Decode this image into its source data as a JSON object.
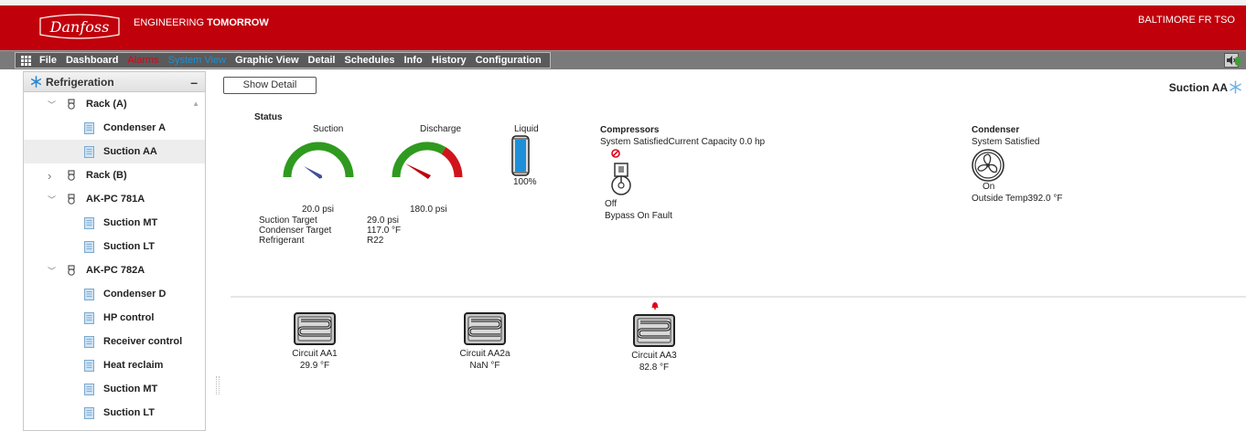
{
  "header": {
    "logo_text": "Danfoss",
    "tagline_prefix": "ENGINEERING",
    "tagline_bold": "TOMORROW",
    "site_name": "BALTIMORE FR TSO"
  },
  "menu": [
    {
      "label": "File",
      "state": "normal"
    },
    {
      "label": "Dashboard",
      "state": "normal"
    },
    {
      "label": "Alarms",
      "state": "alarm"
    },
    {
      "label": "System View",
      "state": "active"
    },
    {
      "label": "Graphic View",
      "state": "normal"
    },
    {
      "label": "Detail",
      "state": "normal"
    },
    {
      "label": "Schedules",
      "state": "normal"
    },
    {
      "label": "Info",
      "state": "normal"
    },
    {
      "label": "History",
      "state": "normal"
    },
    {
      "label": "Configuration",
      "state": "normal"
    }
  ],
  "sidebar": {
    "title": "Refrigeration",
    "collapse_symbol": "–",
    "items": [
      {
        "label": "Rack (A)",
        "type": "group",
        "expanded": true
      },
      {
        "label": "Condenser A",
        "type": "leaf"
      },
      {
        "label": "Suction AA",
        "type": "leaf",
        "selected": true
      },
      {
        "label": "Rack (B)",
        "type": "group",
        "expanded": false
      },
      {
        "label": "AK-PC 781A",
        "type": "group",
        "expanded": true
      },
      {
        "label": "Suction MT",
        "type": "leaf"
      },
      {
        "label": "Suction LT",
        "type": "leaf"
      },
      {
        "label": "AK-PC 782A",
        "type": "group",
        "expanded": true
      },
      {
        "label": "Condenser D",
        "type": "leaf"
      },
      {
        "label": "HP control",
        "type": "leaf"
      },
      {
        "label": "Receiver control",
        "type": "leaf"
      },
      {
        "label": "Heat reclaim",
        "type": "leaf"
      },
      {
        "label": "Suction MT",
        "type": "leaf"
      },
      {
        "label": "Suction LT",
        "type": "leaf"
      }
    ]
  },
  "main": {
    "show_detail_label": "Show Detail",
    "page_title": "Suction AA",
    "status": {
      "title": "Status",
      "suction_label": "Suction",
      "suction_value": "20.0 psi",
      "discharge_label": "Discharge",
      "discharge_value": "180.0 psi",
      "liquid_label": "Liquid",
      "liquid_value": "100%",
      "liquid_level_pct": 100,
      "rows": [
        {
          "label": "Suction Target",
          "value": "29.0 psi"
        },
        {
          "label": "Condenser Target",
          "value": "117.0 °F"
        },
        {
          "label": "Refrigerant",
          "value": "R22"
        }
      ]
    },
    "compressors": {
      "title": "Compressors",
      "status_line": "System SatisfiedCurrent Capacity 0.0 hp",
      "state": "Off",
      "bypass": "Bypass On Fault"
    },
    "condenser": {
      "title": "Condenser",
      "status": "System Satisfied",
      "state": "On",
      "outside_temp": "Outside Temp392.0 °F"
    },
    "circuits": [
      {
        "name": "Circuit AA1",
        "temp": "29.9 °F",
        "alarm": false
      },
      {
        "name": "Circuit AA2a",
        "temp": "NaN °F",
        "alarm": false
      },
      {
        "name": "Circuit AA3",
        "temp": "82.8 °F",
        "alarm": true
      }
    ]
  },
  "colors": {
    "brand_red": "#c0000b",
    "gauge_green": "#2f9a1f",
    "gauge_red": "#d0141c",
    "active_menu": "#1a8fd6",
    "alarm_menu": "#e0001a"
  }
}
